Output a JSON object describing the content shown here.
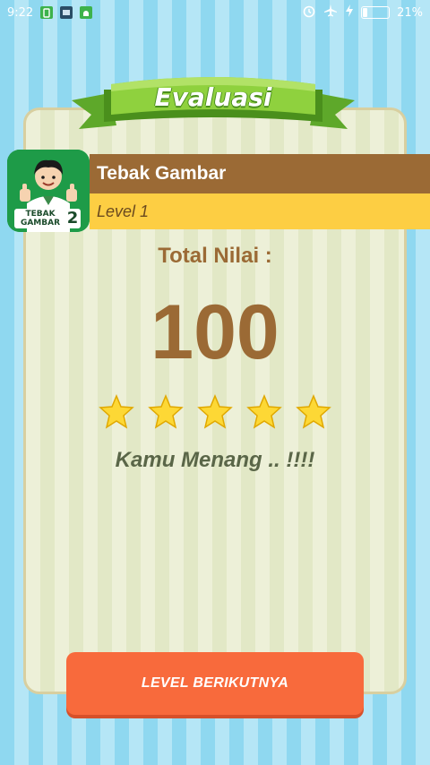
{
  "status_bar": {
    "time": "9:22",
    "battery_percent": "21%",
    "battery_level": 0.21,
    "icons_left": [
      "battery-saver-icon",
      "app-notification-icon",
      "android-icon"
    ],
    "icons_right": [
      "alarm-icon",
      "airplane-mode-icon",
      "charging-icon",
      "battery-icon"
    ]
  },
  "banner": {
    "title": "Evaluasi"
  },
  "game": {
    "name": "Tebak Gambar",
    "level": "Level 1",
    "icon_label_line1": "TEBAK",
    "icon_label_line2": "GAMBAR",
    "icon_number": "2"
  },
  "evaluation": {
    "total_label": "Total Nilai :",
    "score": "100",
    "stars_filled": 5,
    "stars_total": 5,
    "result_message": "Kamu Menang .. !!!!"
  },
  "actions": {
    "next_level_label": "LEVEL BERIKUTNYA"
  },
  "colors": {
    "brown": "#9b6a35",
    "yellow": "#fdce43",
    "orange_button": "#f86a3c",
    "green_banner": "#79c23a",
    "star": "#fdd835"
  }
}
